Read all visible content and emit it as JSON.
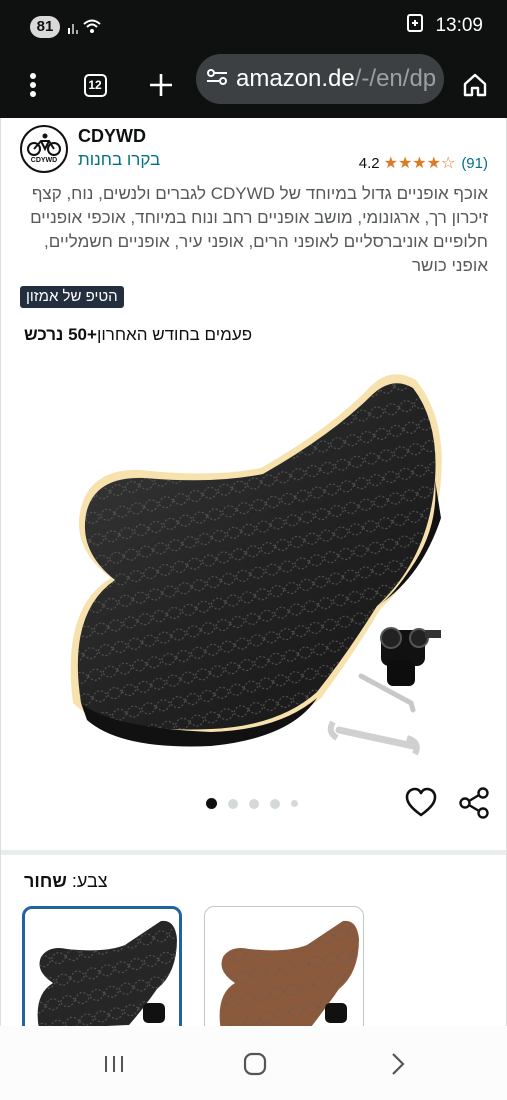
{
  "status_bar": {
    "battery": "81",
    "time": "13:09"
  },
  "browser": {
    "tab_count": "12",
    "url_main": "amazon.de",
    "url_rest": "/-/en/dp"
  },
  "product": {
    "brand": "CDYWD",
    "logo_text": "CDYWD",
    "visit_store": "בקרו בחנות",
    "rating_score": "4.2",
    "rating_stars": "★★★★☆",
    "rating_count": "(91)",
    "title": "אוכף אופניים גדול במיוחד של CDYWD לגברים ולנשים, נוח, קצף זיכרון רך, ארגונומי, מושב אופניים רחב ונוח במיוחד, אוכפי אופניים חלופיים אוניברסליים לאופני הרים, אופני עיר, אופניים חשמליים, אופני כושר",
    "badge": "הטיפ של אמזון",
    "bought_count": "+50 נרכש",
    "bought_suffix": "פעמים בחודש האחרון"
  },
  "gallery": {
    "dots": 5,
    "active_dot": 0
  },
  "variation": {
    "label": "צבע:",
    "selected": "שחור",
    "options": [
      "black",
      "brown"
    ]
  },
  "icons": {
    "menu": "more-vert-icon",
    "new_tab": "plus-icon",
    "site_settings": "tune-icon",
    "home": "home-icon",
    "wishlist": "heart-icon",
    "share": "share-icon"
  },
  "colors": {
    "link": "#007185",
    "star": "#de7921",
    "badge_bg": "#232f3e",
    "selected_border": "#2162a1"
  }
}
